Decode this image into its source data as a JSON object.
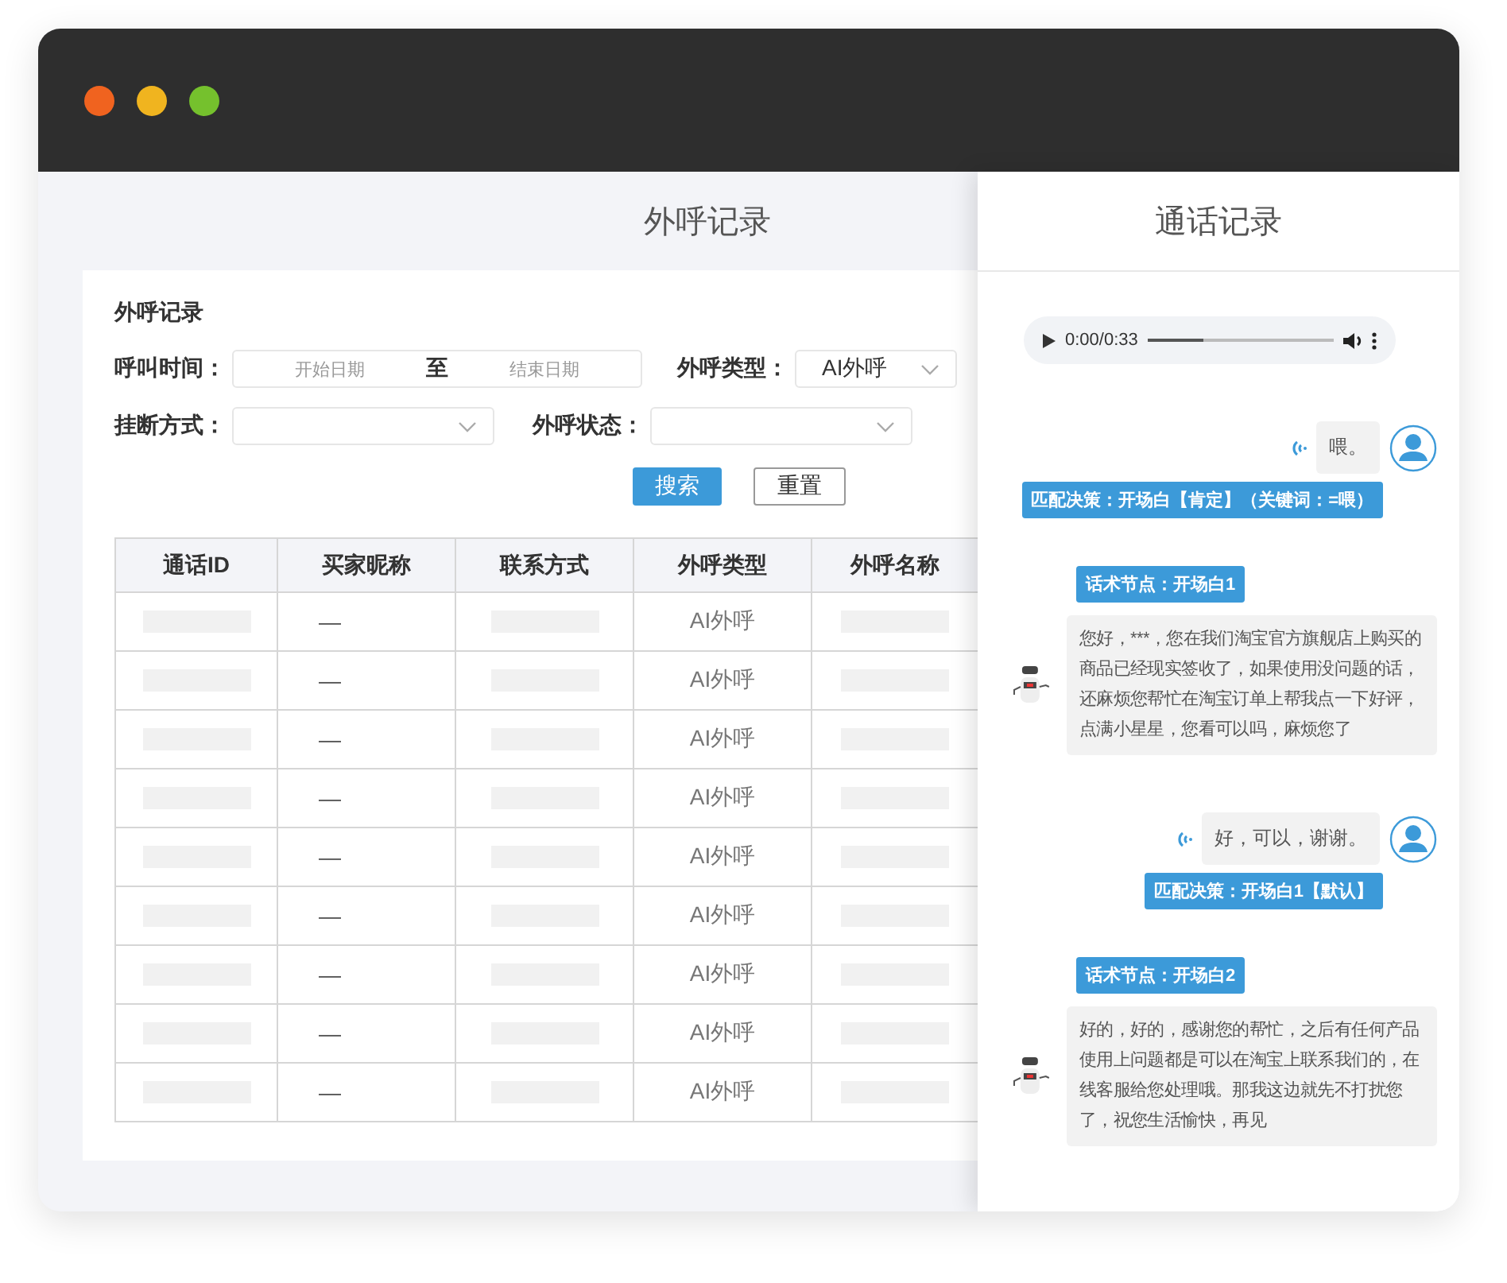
{
  "window": {
    "title": "外呼记录"
  },
  "filter": {
    "title": "外呼记录",
    "call_time": {
      "label": "呼叫时间：",
      "start_placeholder": "开始日期",
      "separator": "至",
      "end_placeholder": "结束日期"
    },
    "call_type": {
      "label": "外呼类型：",
      "value": "AI外呼"
    },
    "hangup": {
      "label": "挂断方式："
    },
    "status": {
      "label": "外呼状态："
    },
    "buttons": [
      {
        "label": "搜索",
        "kind": "primary"
      },
      {
        "label": "重置",
        "kind": "default"
      }
    ]
  },
  "table": {
    "columns": [
      "通话ID",
      "买家昵称",
      "联系方式",
      "外呼类型",
      "外呼名称"
    ],
    "rows": [
      [
        {
          "kind": "redacted"
        },
        {
          "kind": "text",
          "text": "—"
        },
        {
          "kind": "redacted"
        },
        {
          "kind": "text",
          "text": "AI外呼"
        },
        {
          "kind": "redacted"
        }
      ],
      [
        {
          "kind": "redacted"
        },
        {
          "kind": "text",
          "text": "—"
        },
        {
          "kind": "redacted"
        },
        {
          "kind": "text",
          "text": "AI外呼"
        },
        {
          "kind": "redacted"
        }
      ],
      [
        {
          "kind": "redacted"
        },
        {
          "kind": "text",
          "text": "—"
        },
        {
          "kind": "redacted"
        },
        {
          "kind": "text",
          "text": "AI外呼"
        },
        {
          "kind": "redacted"
        }
      ],
      [
        {
          "kind": "redacted"
        },
        {
          "kind": "text",
          "text": "—"
        },
        {
          "kind": "redacted"
        },
        {
          "kind": "text",
          "text": "AI外呼"
        },
        {
          "kind": "redacted"
        }
      ],
      [
        {
          "kind": "redacted"
        },
        {
          "kind": "text",
          "text": "—"
        },
        {
          "kind": "redacted"
        },
        {
          "kind": "text",
          "text": "AI外呼"
        },
        {
          "kind": "redacted"
        }
      ],
      [
        {
          "kind": "redacted"
        },
        {
          "kind": "text",
          "text": "—"
        },
        {
          "kind": "redacted"
        },
        {
          "kind": "text",
          "text": "AI外呼"
        },
        {
          "kind": "redacted"
        }
      ],
      [
        {
          "kind": "redacted"
        },
        {
          "kind": "text",
          "text": "—"
        },
        {
          "kind": "redacted"
        },
        {
          "kind": "text",
          "text": "AI外呼"
        },
        {
          "kind": "redacted"
        }
      ],
      [
        {
          "kind": "redacted"
        },
        {
          "kind": "text",
          "text": "—"
        },
        {
          "kind": "redacted"
        },
        {
          "kind": "text",
          "text": "AI外呼"
        },
        {
          "kind": "redacted"
        }
      ],
      [
        {
          "kind": "redacted"
        },
        {
          "kind": "text",
          "text": "—"
        },
        {
          "kind": "redacted"
        },
        {
          "kind": "text",
          "text": "AI外呼"
        },
        {
          "kind": "redacted"
        }
      ]
    ]
  },
  "call_panel": {
    "title": "通话记录",
    "audio": {
      "time": "0:00/0:33",
      "level": 0.3
    },
    "messages": [
      {
        "kind": "customer",
        "text": "喂。",
        "decision": "匹配决策：开场白【肯定】（关键词：=喂）"
      },
      {
        "kind": "bot",
        "node": "话术节点：开场白1",
        "text": "您好，***，您在我们淘宝官方旗舰店上购买的商品已经现实签收了，如果使用没问题的话，还麻烦您帮忙在淘宝订单上帮我点一下好评，点满小星星，您看可以吗，麻烦您了"
      },
      {
        "kind": "customer",
        "text": "好，可以，谢谢。",
        "decision": "匹配决策：开场白1【默认】"
      },
      {
        "kind": "bot",
        "node": "话术节点：开场白2",
        "text": "好的，好的，感谢您的帮忙，之后有任何产品使用上问题都是可以在淘宝上联系我们的，在线客服给您处理哦。那我这边就先不打扰您了，祝您生活愉快，再见"
      }
    ]
  }
}
